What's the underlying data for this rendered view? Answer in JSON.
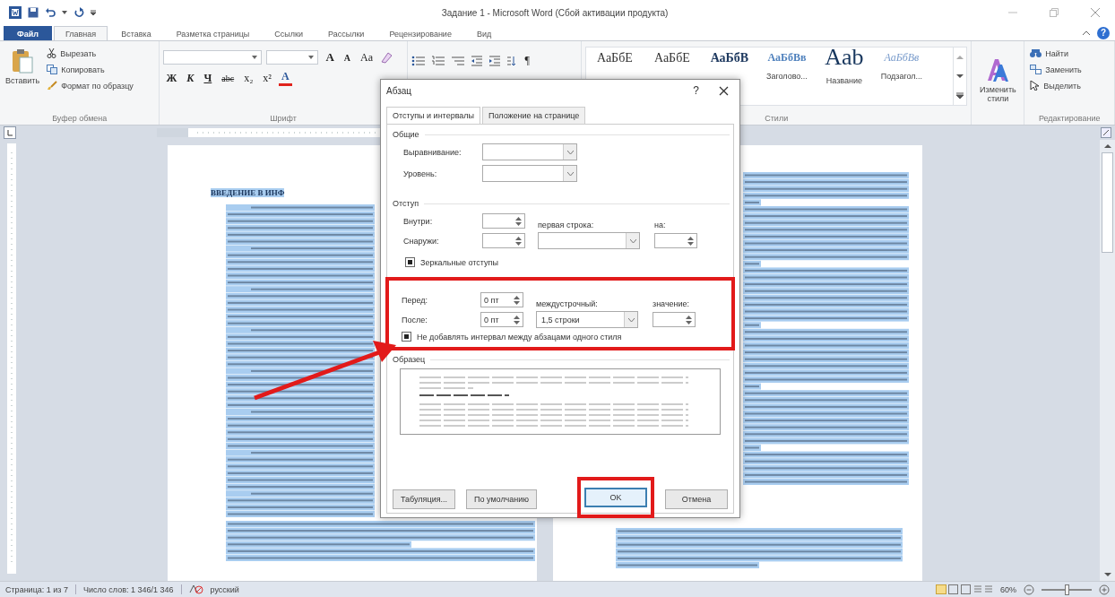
{
  "window": {
    "title": "Задание 1 - Microsoft Word (Сбой активации продукта)",
    "help": "?"
  },
  "ribbon_tabs": [
    {
      "label": "Файл",
      "kind": "file",
      "selected": false
    },
    {
      "label": "Главная",
      "kind": "tab",
      "selected": true
    },
    {
      "label": "Вставка",
      "kind": "tab",
      "selected": false
    },
    {
      "label": "Разметка страницы",
      "kind": "tab",
      "selected": false
    },
    {
      "label": "Ссылки",
      "kind": "tab",
      "selected": false
    },
    {
      "label": "Рассылки",
      "kind": "tab",
      "selected": false
    },
    {
      "label": "Рецензирование",
      "kind": "tab",
      "selected": false
    },
    {
      "label": "Вид",
      "kind": "tab",
      "selected": false
    }
  ],
  "clipboard": {
    "paste": "Вставить",
    "cut": "Вырезать",
    "copy": "Копировать",
    "format_painter": "Формат по образцу",
    "group_label": "Буфер обмена"
  },
  "font": {
    "row1": [
      {
        "text": "A",
        "kind": "grow"
      },
      {
        "text": "A",
        "kind": "shrink"
      },
      {
        "text": "Aa",
        "kind": "case"
      }
    ],
    "row2": [
      {
        "text": "Ж",
        "kind": "bold"
      },
      {
        "text": "К",
        "kind": "italic"
      },
      {
        "text": "Ч",
        "kind": "underline"
      },
      {
        "text": "abc",
        "kind": "strike"
      },
      {
        "text": "x₂",
        "kind": "plain"
      },
      {
        "text": "x²",
        "kind": "plain"
      },
      {
        "text": "A",
        "kind": "color"
      }
    ],
    "group_label": "Шрифт"
  },
  "paragraph": {
    "pilcrow": "¶"
  },
  "styles": {
    "gallery": [
      {
        "sample": "АаБбЕ",
        "kind": "normal"
      },
      {
        "sample": "АаБбЕ",
        "kind": "normal"
      },
      {
        "sample": "АаБбВ",
        "kind": "bold"
      },
      {
        "sample": "АаБбВв",
        "kind": "heading",
        "name": "Заголово..."
      },
      {
        "sample": "Aab",
        "kind": "title",
        "name": "Название"
      },
      {
        "sample": "АаБбВв",
        "kind": "subtitle",
        "name": "Подзагол..."
      }
    ],
    "change_styles": "Изменить стили",
    "group_label": "Стили"
  },
  "editing": {
    "find": "Найти",
    "replace": "Заменить",
    "select": "Выделить",
    "group_label": "Редактирование"
  },
  "document": {
    "heading": "ВВЕДЕНИЕ В ИНФ"
  },
  "dialog": {
    "title": "Абзац",
    "help": "?",
    "tabs": [
      {
        "label": "Отступы и интервалы",
        "selected": true
      },
      {
        "label": "Положение на странице",
        "selected": false
      }
    ],
    "general": {
      "title": "Общие",
      "alignment": "Выравнивание:",
      "level": "Уровень:"
    },
    "indent": {
      "title": "Отступ",
      "inside": "Внутри:",
      "outside": "Снаружи:",
      "first_line": "первая строка:",
      "by": "на:",
      "mirror": {
        "label": "Зеркальные отступы",
        "checked": true
      }
    },
    "spacing": {
      "highlighted": true,
      "before": {
        "label": "Перед:",
        "value": "0 пт"
      },
      "after": {
        "label": "После:",
        "value": "0 пт"
      },
      "line": {
        "label": "междустрочный:",
        "value": "1,5 строки"
      },
      "at": "значение:",
      "no_space": {
        "label": "Не добавлять интервал между абзацами одного стиля",
        "checked": true
      }
    },
    "preview": {
      "title": "Образец"
    },
    "buttons": [
      {
        "label": "Табуляция...",
        "highlighted": false
      },
      {
        "label": "По умолчанию",
        "highlighted": false
      },
      {
        "label": "OK",
        "highlighted": true
      },
      {
        "label": "Отмена",
        "highlighted": false
      }
    ]
  },
  "status_bar": {
    "page": "Страница: 1 из 7",
    "words": "Число слов: 1 346/1 346",
    "language": "русский",
    "zoom": "60%",
    "zoom_slider": {
      "level": 0.5
    }
  }
}
